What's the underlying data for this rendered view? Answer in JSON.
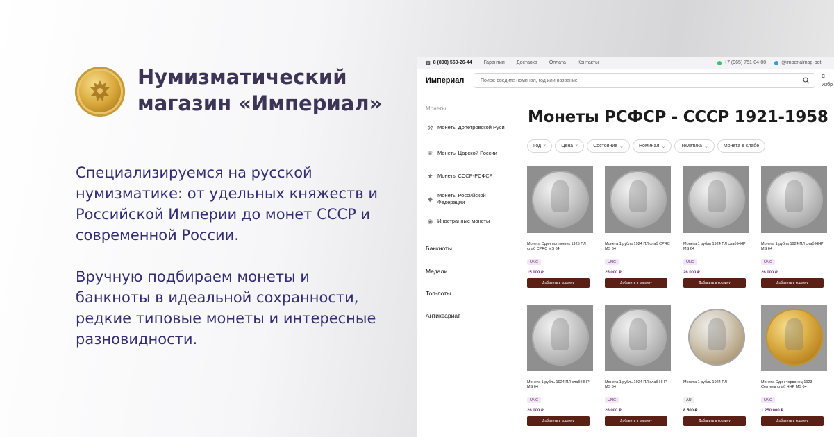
{
  "promo": {
    "title_line1": "Нумизматический",
    "title_line2": "магазин «Империал»",
    "paragraph1": "Специализируемся на русской нумизматике: от удельных княжеств и Российской Империи до монет СССР и современной России.",
    "paragraph2": "Вручную подбираем монеты и банкноты в идеальной сохранности, редкие типовые монеты и интересные разновидности."
  },
  "topbar": {
    "phone": "8 (800) 550-26-44",
    "links": [
      "Гарантии",
      "Доставка",
      "Оплата",
      "Контакты"
    ],
    "whatsapp": "+7 (965) 751-04-00",
    "telegram": "@imperialmag-bot"
  },
  "header": {
    "brand": "Империал",
    "search_placeholder": "Поиск: введите номинал, год или название",
    "extra_top": "С",
    "extra_bottom": "Избр"
  },
  "sidebar": {
    "heading": "Монеты",
    "items": [
      {
        "icon": "axe-icon",
        "label": "Монеты Допетровской Руси"
      },
      {
        "icon": "crown-icon",
        "label": "Монеты Царской России"
      },
      {
        "icon": "star-icon",
        "label": "Монеты СССР-РСФСР"
      },
      {
        "icon": "bear-icon",
        "label": "Монеты Российской Федерации"
      },
      {
        "icon": "globe-icon",
        "label": "Иностранные монеты"
      }
    ],
    "main": [
      "Банкноты",
      "Медали",
      "Топ-лоты",
      "Антиквариат"
    ]
  },
  "content": {
    "title": "Монеты РСФСР - СССР 1921-1958",
    "filters": [
      {
        "label": "Год",
        "mark": "×"
      },
      {
        "label": "Цена",
        "mark": "×"
      },
      {
        "label": "Состояние",
        "mark": "⌄"
      },
      {
        "label": "Номинал",
        "mark": "⌄"
      },
      {
        "label": "Тематика",
        "mark": "⌄"
      },
      {
        "label": "Монета в слабе",
        "mark": ""
      }
    ],
    "buy_label": "Добавить в корзину",
    "products": [
      {
        "title": "Монета Один полтинник 1925 ПЛ слаб CPRC MS 64",
        "grade": "UNC",
        "price": "15 000 ₽"
      },
      {
        "title": "Монета 1 рубль 1924 ПЛ слаб CPRC MS 64",
        "grade": "UNC",
        "price": "25 000 ₽"
      },
      {
        "title": "Монета 1 рубль 1924 ПЛ слаб ННР MS 64",
        "grade": "UNC",
        "price": "26 000 ₽"
      },
      {
        "title": "Монета 1 рубль 1924 ПЛ слаб ННР MS 64",
        "grade": "UNC",
        "price": "26 000 ₽"
      },
      {
        "title": "Монета 1 рубль 1924 ПЛ слаб ННР MS 64",
        "grade": "UNC",
        "price": "26 000 ₽"
      },
      {
        "title": "Монета 1 рубль 1924 ПЛ слаб ННР MS 64",
        "grade": "UNC",
        "price": "26 000 ₽"
      },
      {
        "title": "Монета 1 рубль 1924 ПЛ",
        "grade": "AU",
        "price": "8 500 ₽"
      },
      {
        "title": "Монета Один червонец 1923 Сеятель слаб ННР MS 64",
        "grade": "UNC",
        "price": "1 250 000 ₽"
      }
    ]
  }
}
